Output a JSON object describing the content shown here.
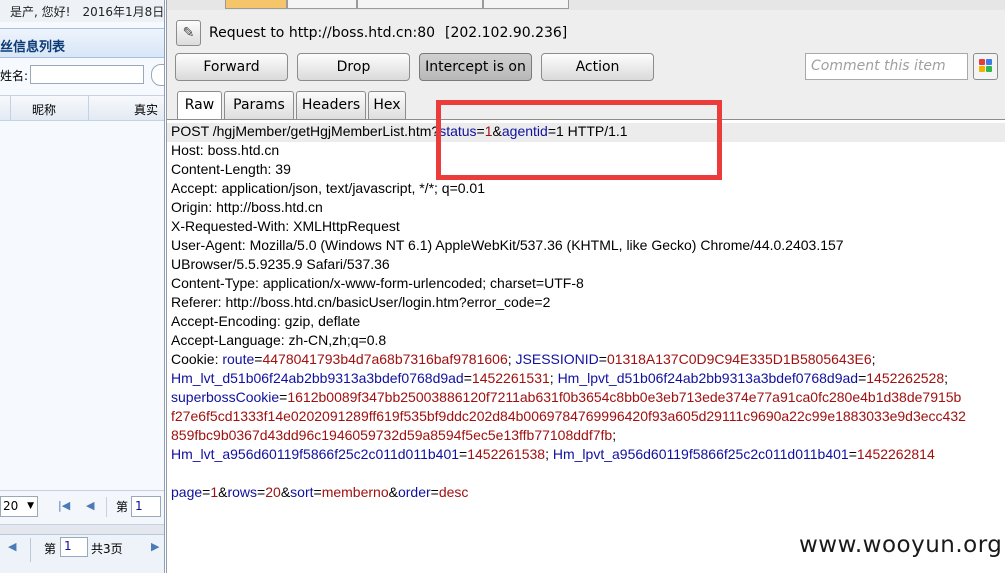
{
  "left_app": {
    "greeting": "是产, 您好!",
    "date": "2016年1月8日",
    "panel_title": "丝信息列表",
    "search_label": "姓名:",
    "columns": [
      "昵称",
      "真实"
    ],
    "page_size": "20",
    "page_label": "第",
    "page_value": "1",
    "bottom_page_label": "第",
    "bottom_page_value": "1",
    "bottom_total": "共3页"
  },
  "burp": {
    "request_to": "Request to http://boss.htd.cn:80",
    "request_ip": "[202.102.90.236]",
    "buttons": {
      "forward": "Forward",
      "drop": "Drop",
      "intercept": "Intercept is on",
      "action": "Action"
    },
    "comment_placeholder": "Comment this item",
    "tabs": [
      "Raw",
      "Params",
      "Headers",
      "Hex"
    ],
    "request": {
      "line1": {
        "method": "POST /hgjMember/getHgjMemberList.htm?",
        "p1_name": "status",
        "eq1": "=",
        "p1_value": "1",
        "amp1": "&",
        "p2_name": "agentid",
        "eq2": "=",
        "p2_value": "1",
        "tail": " HTTP/1.1"
      },
      "host": "Host: boss.htd.cn",
      "content_length": "Content-Length: 39",
      "accept": "Accept: application/json, text/javascript, */*; q=0.01",
      "origin": "Origin: http://boss.htd.cn",
      "xrw": "X-Requested-With: XMLHttpRequest",
      "user_agent_1": "User-Agent: Mozilla/5.0 (Windows NT 6.1) AppleWebKit/537.36 (KHTML, like Gecko) Chrome/44.0.2403.157",
      "user_agent_2": "UBrowser/5.5.9235.9 Safari/537.36",
      "content_type": "Content-Type: application/x-www-form-urlencoded; charset=UTF-8",
      "referer": "Referer: http://boss.htd.cn/basicUser/login.htm?error_code=2",
      "accept_encoding": "Accept-Encoding: gzip, deflate",
      "accept_language": "Accept-Language: zh-CN,zh;q=0.8",
      "cookie": {
        "label": "Cookie: ",
        "route_name": "route",
        "route_value": "4478041793b4d7a68b7316baf9781606",
        "jsession_name": "JSESSIONID",
        "jsession_value": "01318A137C0D9C94E335D1B5805643E6",
        "lvt1_name": "Hm_lvt_d51b06f24ab2bb9313a3bdef0768d9ad",
        "lvt1_value": "1452261531",
        "lpvt1_name": "Hm_lpvt_d51b06f24ab2bb9313a3bdef0768d9ad",
        "lpvt1_value": "1452262528",
        "superboss_name": "superbossCookie",
        "superboss_value_1": "1612b0089f347bb25003886120f7211ab631f0b3654c8bb0e3eb713ede374e77a91ca0fc280e4b1d38de7915b",
        "superboss_value_2": "f27e6f5cd1333f14e0202091289ff619f535bf9ddc202d84b0069784769996420f93a605d29111c9690a22c99e1883033e9d3ecc432",
        "superboss_value_3": "859fbc9b0367d43dd96c1946059732d59a8594f5ec5e13ffb77108ddf7fb",
        "lvt2_name": "Hm_lvt_a956d60119f5866f25c2c011d011b401",
        "lvt2_value": "1452261538",
        "lpvt2_name": "Hm_lpvt_a956d60119f5866f25c2c011d011b401",
        "lpvt2_value": "1452262814"
      },
      "body": {
        "page_name": "page",
        "page_value": "1",
        "rows_name": "rows",
        "rows_value": "20",
        "sort_name": "sort",
        "sort_value": "memberno",
        "order_name": "order",
        "order_value": "desc"
      }
    },
    "watermark": "www.wooyun.org",
    "colors": {
      "highlight_box": "#ec3b3b",
      "param_name": "#1010a0",
      "param_value": "#a01010"
    }
  }
}
